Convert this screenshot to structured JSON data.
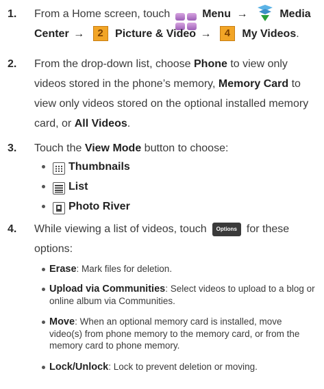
{
  "step1": {
    "num": "1.",
    "from": "From a Home screen, touch",
    "menu": "Menu",
    "arrow1": "→",
    "media": "Media",
    "center": "Center",
    "arrow2": "→",
    "n2": "2",
    "picture_video": "Picture & Video",
    "arrow3": "→",
    "n4": "4",
    "my_videos": "My Videos",
    "dot": "."
  },
  "step2": {
    "num": "2.",
    "t1": "From the drop-down list, choose ",
    "phone": "Phone",
    "t2": " to view only videos stored in the phone’s memory, ",
    "memory_card": "Memory Card",
    "t3": " to view only videos stored on the optional installed memory card, or ",
    "all_videos": "All Videos",
    "t4": "."
  },
  "step3": {
    "num": "3.",
    "t1": "Touch the ",
    "view_mode": "View Mode",
    "t2": " button to choose:",
    "options": [
      "Thumbnails",
      "List",
      "Photo River"
    ]
  },
  "step4": {
    "num": "4.",
    "t1": "While viewing a list of videos, touch",
    "options_btn": "Options",
    "t2": "for these",
    "t3": "options:",
    "items": [
      {
        "title": "Erase",
        "desc": ": Mark files for deletion."
      },
      {
        "title": "Upload via Communities",
        "desc": ": Select videos to upload to a blog or online album via Communities."
      },
      {
        "title": "Move",
        "desc": ": When an optional memory card is installed, move video(s) from phone memory to the memory card, or from the memory card to phone memory."
      },
      {
        "title": "Lock/Unlock",
        "desc": ": Lock to prevent deletion or moving."
      }
    ]
  }
}
